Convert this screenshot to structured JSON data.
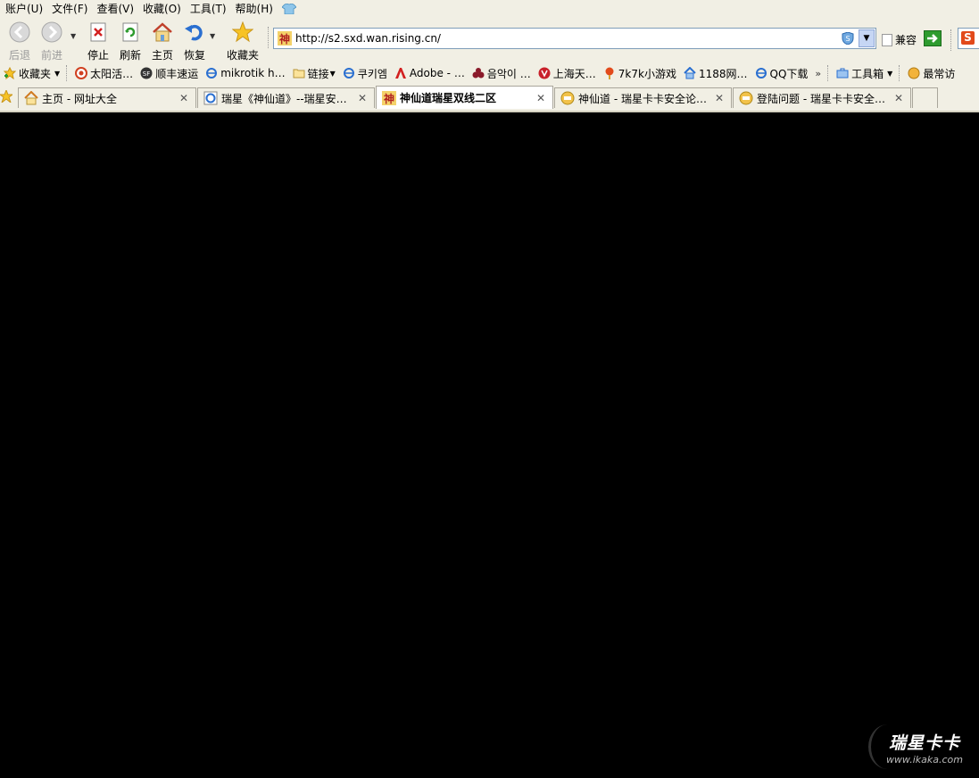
{
  "menubar": {
    "items": [
      "账户(U)",
      "文件(F)",
      "查看(V)",
      "收藏(O)",
      "工具(T)",
      "帮助(H)"
    ]
  },
  "toolbar": {
    "back_label": "后退",
    "forward_label": "前进",
    "stop_label": "停止",
    "refresh_label": "刷新",
    "home_label": "主页",
    "restore_label": "恢复",
    "favorites_label": "收藏夹"
  },
  "address": {
    "url": "http://s2.sxd.wan.rising.cn/",
    "compat_label": "兼容"
  },
  "favbar": {
    "favorites_label": "收藏夹",
    "items": [
      "太阳活…",
      "顺丰速运",
      "mikrotik h…",
      "链接",
      "쿠키엠",
      "Adobe - …",
      "음악이 …",
      "上海天…",
      "7k7k小游戏",
      "1188网…",
      "QQ下载"
    ],
    "toolbox_label": "工具箱",
    "frequent_label": "最常访"
  },
  "tabs": [
    {
      "title": "主页 - 网址大全",
      "active": false
    },
    {
      "title": "瑞星《神仙道》--瑞星安…",
      "active": false
    },
    {
      "title": "神仙道瑞星双线二区",
      "active": true
    },
    {
      "title": "神仙道 - 瑞星卡卡安全论…",
      "active": false
    },
    {
      "title": "登陆问题 - 瑞星卡卡安全…",
      "active": false
    }
  ],
  "watermark": {
    "logo": "瑞星卡卡",
    "url": "www.ikaka.com"
  },
  "icons": {
    "back": "back-arrow-icon",
    "forward": "forward-arrow-icon",
    "stop": "stop-icon",
    "refresh": "refresh-icon",
    "home": "home-icon",
    "restore": "undo-icon",
    "favorites": "star-icon"
  },
  "colors": {
    "chrome_bg": "#f1efe4",
    "content_bg": "#000000"
  }
}
